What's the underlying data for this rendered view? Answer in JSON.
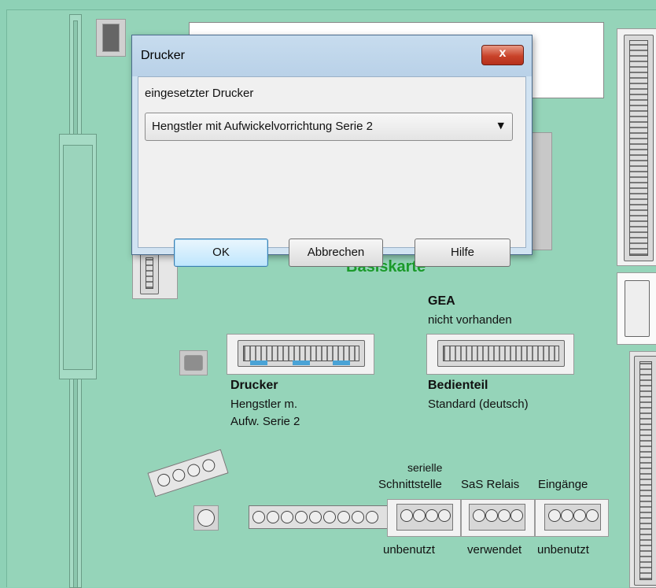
{
  "dialog": {
    "title": "Drucker",
    "close_label": "x",
    "caption": "eingesetzter Drucker",
    "printer_select": {
      "value": "Hengstler mit Aufwickelvorrichtung Serie 2"
    },
    "buttons": {
      "ok": "OK",
      "cancel": "Abbrechen",
      "help": "Hilfe"
    }
  },
  "board": {
    "title": "Basiskarte",
    "gea": {
      "name": "GEA",
      "status": "nicht vorhanden"
    },
    "drucker": {
      "name": "Drucker",
      "line1": "Hengstler m.",
      "line2": "Aufw. Serie 2"
    },
    "bedienteil": {
      "name": "Bedienteil",
      "value": "Standard (deutsch)"
    },
    "ports": {
      "seriell_line1": "serielle",
      "seriell_line2": "Schnittstelle",
      "sas_relais": "SaS Relais",
      "eingaenge": "Eingänge",
      "status_seriell": "unbenutzt",
      "status_relais": "verwendet",
      "status_eingaenge": "unbenutzt"
    }
  },
  "colors": {
    "board": "#95d4b9",
    "title_green": "#1b9a2a",
    "dialog_frame": "#d1e3f2"
  }
}
